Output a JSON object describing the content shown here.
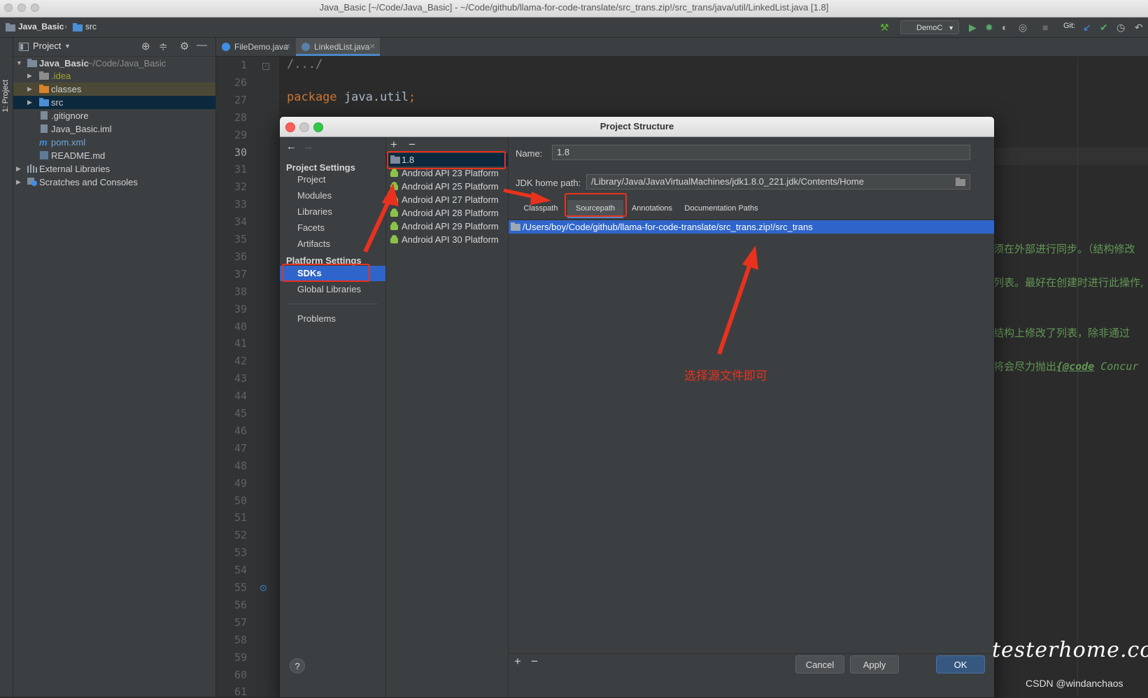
{
  "window": {
    "title": "Java_Basic [~/Code/Java_Basic] - ~/Code/github/llama-for-code-translate/src_trans.zip!/src_trans/java/util/LinkedList.java [1.8]"
  },
  "navbar": {
    "breadcrumb": [
      "Java_Basic",
      "src"
    ],
    "run_config": "DemoC",
    "git_label": "Git:"
  },
  "left_stripe": {
    "label": "1: Project"
  },
  "project_panel": {
    "header": "Project",
    "tree": [
      {
        "label": "Java_Basic",
        "suffix": "~/Code/Java_Basic"
      },
      {
        "label": ".idea"
      },
      {
        "label": "classes"
      },
      {
        "label": "src"
      },
      {
        "label": ".gitignore"
      },
      {
        "label": "Java_Basic.iml"
      },
      {
        "label": "pom.xml"
      },
      {
        "label": "README.md"
      },
      {
        "label": "External Libraries"
      },
      {
        "label": "Scratches and Consoles"
      }
    ]
  },
  "editor": {
    "tabs": [
      {
        "label": "FileDemo.java"
      },
      {
        "label": "LinkedList.java"
      }
    ],
    "line_numbers": [
      "1",
      "26",
      "27",
      "28",
      "29",
      "30",
      "31",
      "32",
      "33",
      "34",
      "35",
      "36",
      "37",
      "38",
      "39",
      "40",
      "41",
      "42",
      "43",
      "44",
      "45",
      "46",
      "47",
      "48",
      "49",
      "50",
      "51",
      "52",
      "53",
      "54",
      "55",
      "56",
      "57",
      "58",
      "59",
      "60",
      "61"
    ],
    "code": {
      "line1": "/.../",
      "keyword": "package",
      "pkg": " java.util",
      "semi": ";"
    },
    "right_fragments": [
      "须在外部进行同步。（结构修改",
      "列表。最好在创建时进行此操作,",
      "结构上修改了列表，除非通过",
      "将会尽力抛出",
      "{@code",
      " Concur"
    ]
  },
  "dialog": {
    "title": "Project Structure",
    "nav": {
      "project_settings_header": "Project Settings",
      "project_settings": [
        "Project",
        "Modules",
        "Libraries",
        "Facets",
        "Artifacts"
      ],
      "platform_settings_header": "Platform Settings",
      "platform_settings": [
        "SDKs",
        "Global Libraries"
      ],
      "problems": "Problems"
    },
    "sdk_toolbar": {
      "add": "+",
      "remove": "−"
    },
    "sdks": [
      "1.8",
      "Android API 23 Platform",
      "Android API 25 Platform",
      "Android API 27 Platform",
      "Android API 28 Platform",
      "Android API 29 Platform",
      "Android API 30 Platform"
    ],
    "detail": {
      "name_label": "Name:",
      "name_value": "1.8",
      "jdk_label": "JDK home path:",
      "jdk_value": "/Library/Java/JavaVirtualMachines/jdk1.8.0_221.jdk/Contents/Home",
      "tabs": [
        "Classpath",
        "Sourcepath",
        "Annotations",
        "Documentation Paths"
      ],
      "selected_tab": "Sourcepath",
      "paths": [
        "/Users/boy/Code/github/llama-for-code-translate/src_trans.zip!/src_trans"
      ],
      "add": "+",
      "remove": "−"
    },
    "buttons": {
      "help": "?",
      "cancel": "Cancel",
      "apply": "Apply",
      "ok": "OK"
    }
  },
  "annotation": {
    "text": "选择源文件即可"
  },
  "watermark": {
    "site": "testerhome.com",
    "csdn": "CSDN @windanchaos"
  },
  "colors": {
    "selection": "#2f65ca",
    "nav_selection": "#2f65ca",
    "red_annotation": "#e8321e",
    "keyword": "#cc7832",
    "comment_green": "#629755"
  }
}
